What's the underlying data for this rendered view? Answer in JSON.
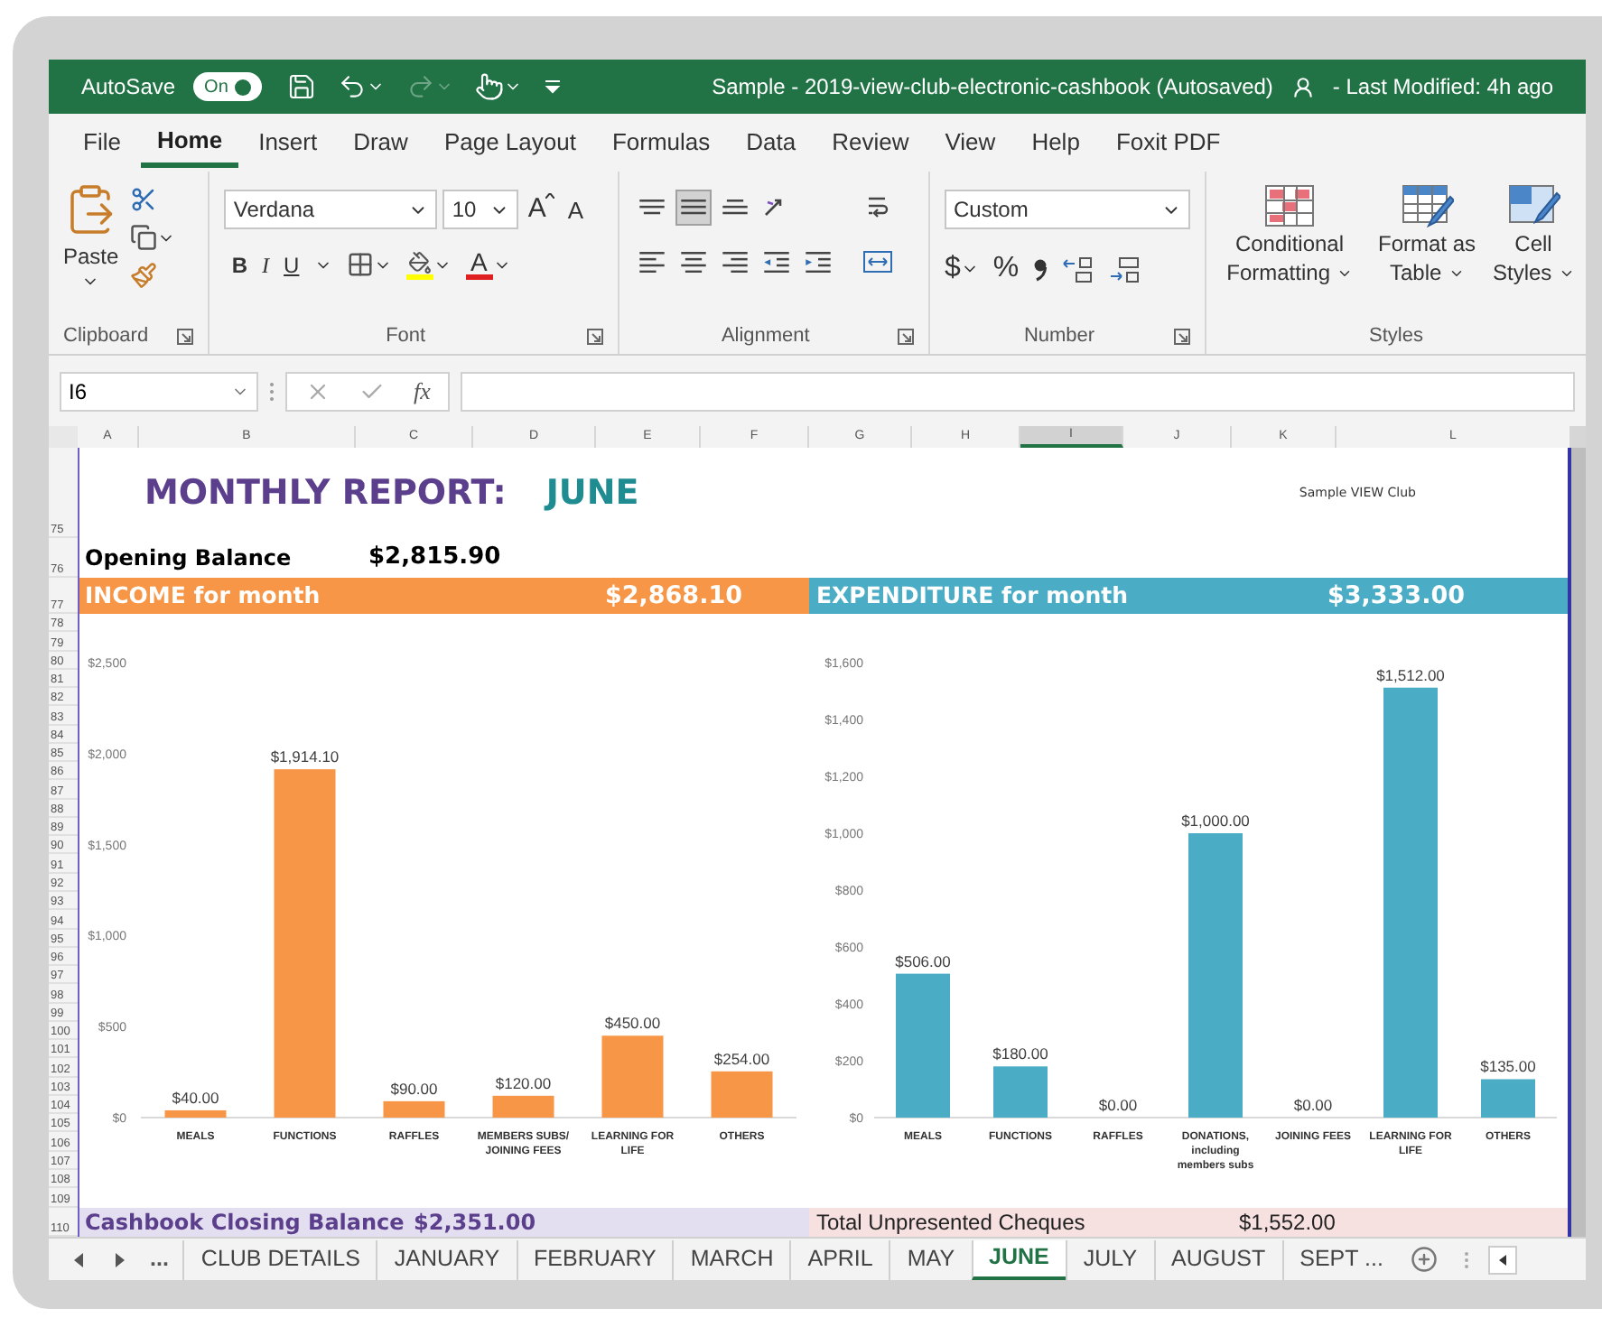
{
  "title_bar": {
    "autosave_label": "AutoSave",
    "autosave_on": true,
    "autosave_state": "On",
    "quick_access": [
      {
        "kind": "save",
        "disabled": false
      },
      {
        "kind": "undo",
        "disabled": false
      },
      {
        "kind": "redo",
        "disabled": true
      },
      {
        "kind": "touch",
        "disabled": false
      },
      {
        "kind": "customize",
        "disabled": false
      }
    ],
    "title": "Sample - 2019-view-club-electronic-cashbook (Autosaved)",
    "last_modified": "- Last Modified: 4h ago"
  },
  "menu_tabs": [
    {
      "label": "File",
      "selected": false
    },
    {
      "label": "Home",
      "selected": true
    },
    {
      "label": "Insert",
      "selected": false
    },
    {
      "label": "Draw",
      "selected": false
    },
    {
      "label": "Page Layout",
      "selected": false
    },
    {
      "label": "Formulas",
      "selected": false
    },
    {
      "label": "Data",
      "selected": false
    },
    {
      "label": "Review",
      "selected": false
    },
    {
      "label": "View",
      "selected": false
    },
    {
      "label": "Help",
      "selected": false
    },
    {
      "label": "Foxit PDF",
      "selected": false
    }
  ],
  "ribbon": {
    "clipboard": {
      "paste": "Paste",
      "label": "Clipboard"
    },
    "font": {
      "name": "Verdana",
      "size": "10",
      "grow": "A",
      "shrink": "A",
      "bold": "B",
      "italic": "I",
      "underline": "U",
      "color_letter": "A",
      "label": "Font"
    },
    "alignment": {
      "label": "Alignment",
      "buttons": [
        {
          "kind": "top",
          "selected": false
        },
        {
          "kind": "middle",
          "selected": true
        },
        {
          "kind": "bottom",
          "selected": false
        },
        {
          "kind": "orientation",
          "selected": false
        },
        {
          "kind": "wrap",
          "selected": false
        },
        {
          "kind": "left",
          "selected": false
        },
        {
          "kind": "center",
          "selected": false
        },
        {
          "kind": "right",
          "selected": false
        },
        {
          "kind": "outdent",
          "selected": false
        },
        {
          "kind": "indent",
          "selected": false
        },
        {
          "kind": "merge",
          "selected": false
        }
      ]
    },
    "number": {
      "format": "Custom",
      "currency": "$",
      "percent": "%",
      "label": "Number"
    },
    "styles": {
      "label": "Styles",
      "buttons": [
        {
          "kind": "conditional",
          "label": "Conditional Formatting"
        },
        {
          "kind": "table",
          "label": "Format as Table"
        },
        {
          "kind": "cell",
          "label": "Cell Styles"
        }
      ]
    }
  },
  "formula_bar": {
    "name_box": "I6",
    "fx": "fx"
  },
  "columns": [
    {
      "label": "A",
      "selected": false
    },
    {
      "label": "B",
      "selected": false
    },
    {
      "label": "C",
      "selected": false
    },
    {
      "label": "D",
      "selected": false
    },
    {
      "label": "E",
      "selected": false
    },
    {
      "label": "F",
      "selected": false
    },
    {
      "label": "G",
      "selected": false
    },
    {
      "label": "H",
      "selected": false
    },
    {
      "label": "I",
      "selected": true
    },
    {
      "label": "J",
      "selected": false
    },
    {
      "label": "K",
      "selected": false
    },
    {
      "label": "L",
      "selected": false
    }
  ],
  "row_numbers": [
    "75",
    "76",
    "77",
    "78",
    "79",
    "80",
    "81",
    "82",
    "83",
    "84",
    "85",
    "86",
    "87",
    "88",
    "89",
    "90",
    "91",
    "92",
    "93",
    "94",
    "95",
    "96",
    "97",
    "98",
    "99",
    "100",
    "101",
    "102",
    "103",
    "104",
    "105",
    "106",
    "107",
    "108",
    "109",
    "110"
  ],
  "sheet": {
    "title": "MONTHLY REPORT:",
    "month": "JUNE",
    "club": "Sample VIEW Club",
    "opening_label": "Opening Balance",
    "opening_value": "$2,815.90",
    "income": {
      "label": "INCOME for month",
      "value": "$2,868.10",
      "chart_data": {
        "type": "bar",
        "categories": [
          "MEALS",
          "FUNCTIONS",
          "RAFFLES",
          "MEMBERS SUBS/ JOINING FEES",
          "LEARNING FOR LIFE",
          "OTHERS"
        ],
        "series": [
          {
            "color": "#f79646",
            "values": [
              40,
              1914,
              90,
              120,
              450,
              254
            ]
          }
        ],
        "ylim": [
          0,
          2500
        ],
        "yticks": [
          {
            "value": 0,
            "label": "$0"
          },
          {
            "value": 500,
            "label": "$500"
          },
          {
            "value": 1000,
            "label": "$1,000"
          },
          {
            "value": 1500,
            "label": "$1,500"
          },
          {
            "value": 2000,
            "label": "$2,000"
          },
          {
            "value": 2500,
            "label": "$2,500"
          }
        ],
        "value_labels": [
          "$40.00",
          "$1,914.10",
          "$90.00",
          "$120.00",
          "$450.00",
          "$254.00"
        ]
      }
    },
    "expenditure": {
      "label": "EXPENDITURE for month",
      "value": "$3,333.00",
      "chart_data": {
        "type": "bar",
        "categories": [
          "MEALS",
          "FUNCTIONS",
          "RAFFLES",
          "DONATIONS, including members subs",
          "JOINING FEES",
          "LEARNING FOR LIFE",
          "OTHERS"
        ],
        "series": [
          {
            "color": "#4bacc6",
            "values": [
              506,
              180,
              0,
              1000,
              0,
              1512,
              135
            ]
          }
        ],
        "ylim": [
          0,
          1600
        ],
        "yticks": [
          {
            "value": 0,
            "label": "$0"
          },
          {
            "value": 200,
            "label": "$200"
          },
          {
            "value": 400,
            "label": "$400"
          },
          {
            "value": 600,
            "label": "$600"
          },
          {
            "value": 800,
            "label": "$800"
          },
          {
            "value": 1000,
            "label": "$1,000"
          },
          {
            "value": 1200,
            "label": "$1,200"
          },
          {
            "value": 1400,
            "label": "$1,400"
          },
          {
            "value": 1600,
            "label": "$1,600"
          }
        ],
        "value_labels": [
          "$506.00",
          "$180.00",
          "$0.00",
          "$1,000.00",
          "$0.00",
          "$1,512.00",
          "$135.00"
        ]
      }
    },
    "closing": {
      "label": "Cashbook Closing Balance",
      "value": "$2,351.00"
    },
    "unpresented": {
      "label": "Total Unpresented Cheques",
      "value": "$1,552.00"
    }
  },
  "sheet_tabs": {
    "more": "...",
    "tabs": [
      {
        "label": "CLUB DETAILS",
        "selected": false
      },
      {
        "label": "JANUARY",
        "selected": false
      },
      {
        "label": "FEBRUARY",
        "selected": false
      },
      {
        "label": "MARCH",
        "selected": false
      },
      {
        "label": "APRIL",
        "selected": false
      },
      {
        "label": "MAY",
        "selected": false
      },
      {
        "label": "JUNE",
        "selected": true
      },
      {
        "label": "JULY",
        "selected": false
      },
      {
        "label": "AUGUST",
        "selected": false
      },
      {
        "label": "SEPT ...",
        "selected": false
      }
    ]
  }
}
